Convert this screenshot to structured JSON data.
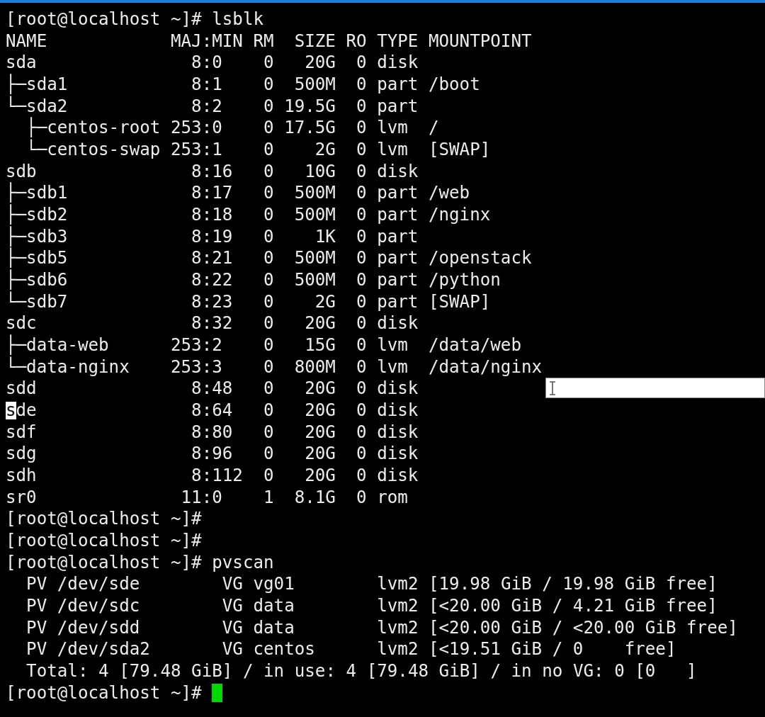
{
  "blocks": [
    {
      "kind": "prompt",
      "text": "[root@localhost ~]# lsblk",
      "cursor": false
    },
    {
      "kind": "lsblk",
      "columns": [
        "NAME",
        "MAJ:MIN",
        "RM",
        "SIZE",
        "RO",
        "TYPE",
        "MOUNTPOINT"
      ],
      "rows": [
        {
          "name": "sda",
          "maj_min": "8:0",
          "rm": "0",
          "size": "20G",
          "ro": "0",
          "type": "disk",
          "mountpoint": "",
          "cursor": false,
          "selection": false
        },
        {
          "name": "├─sda1",
          "maj_min": "8:1",
          "rm": "0",
          "size": "500M",
          "ro": "0",
          "type": "part",
          "mountpoint": "/boot",
          "cursor": false,
          "selection": false
        },
        {
          "name": "└─sda2",
          "maj_min": "8:2",
          "rm": "0",
          "size": "19.5G",
          "ro": "0",
          "type": "part",
          "mountpoint": "",
          "cursor": false,
          "selection": false
        },
        {
          "name": "  ├─centos-root",
          "maj_min": "253:0",
          "rm": "0",
          "size": "17.5G",
          "ro": "0",
          "type": "lvm",
          "mountpoint": "/",
          "cursor": false,
          "selection": false
        },
        {
          "name": "  └─centos-swap",
          "maj_min": "253:1",
          "rm": "0",
          "size": "2G",
          "ro": "0",
          "type": "lvm",
          "mountpoint": "[SWAP]",
          "cursor": false,
          "selection": false
        },
        {
          "name": "sdb",
          "maj_min": "8:16",
          "rm": "0",
          "size": "10G",
          "ro": "0",
          "type": "disk",
          "mountpoint": "",
          "cursor": false,
          "selection": false
        },
        {
          "name": "├─sdb1",
          "maj_min": "8:17",
          "rm": "0",
          "size": "500M",
          "ro": "0",
          "type": "part",
          "mountpoint": "/web",
          "cursor": false,
          "selection": false
        },
        {
          "name": "├─sdb2",
          "maj_min": "8:18",
          "rm": "0",
          "size": "500M",
          "ro": "0",
          "type": "part",
          "mountpoint": "/nginx",
          "cursor": false,
          "selection": false
        },
        {
          "name": "├─sdb3",
          "maj_min": "8:19",
          "rm": "0",
          "size": "1K",
          "ro": "0",
          "type": "part",
          "mountpoint": "",
          "cursor": false,
          "selection": false
        },
        {
          "name": "├─sdb5",
          "maj_min": "8:21",
          "rm": "0",
          "size": "500M",
          "ro": "0",
          "type": "part",
          "mountpoint": "/openstack",
          "cursor": false,
          "selection": false
        },
        {
          "name": "├─sdb6",
          "maj_min": "8:22",
          "rm": "0",
          "size": "500M",
          "ro": "0",
          "type": "part",
          "mountpoint": "/python",
          "cursor": false,
          "selection": false
        },
        {
          "name": "└─sdb7",
          "maj_min": "8:23",
          "rm": "0",
          "size": "2G",
          "ro": "0",
          "type": "part",
          "mountpoint": "[SWAP]",
          "cursor": false,
          "selection": false
        },
        {
          "name": "sdc",
          "maj_min": "8:32",
          "rm": "0",
          "size": "20G",
          "ro": "0",
          "type": "disk",
          "mountpoint": "",
          "cursor": false,
          "selection": false
        },
        {
          "name": "├─data-web",
          "maj_min": "253:2",
          "rm": "0",
          "size": "15G",
          "ro": "0",
          "type": "lvm",
          "mountpoint": "/data/web",
          "cursor": false,
          "selection": false
        },
        {
          "name": "└─data-nginx",
          "maj_min": "253:3",
          "rm": "0",
          "size": "800M",
          "ro": "0",
          "type": "lvm",
          "mountpoint": "/data/nginx",
          "cursor": false,
          "selection": false
        },
        {
          "name": "sdd",
          "maj_min": "8:48",
          "rm": "0",
          "size": "20G",
          "ro": "0",
          "type": "disk",
          "mountpoint": "",
          "cursor": false,
          "selection": true
        },
        {
          "name": "sde",
          "maj_min": "8:64",
          "rm": "0",
          "size": "20G",
          "ro": "0",
          "type": "disk",
          "mountpoint": "",
          "cursor": true,
          "selection": false
        },
        {
          "name": "sdf",
          "maj_min": "8:80",
          "rm": "0",
          "size": "20G",
          "ro": "0",
          "type": "disk",
          "mountpoint": "",
          "cursor": false,
          "selection": false
        },
        {
          "name": "sdg",
          "maj_min": "8:96",
          "rm": "0",
          "size": "20G",
          "ro": "0",
          "type": "disk",
          "mountpoint": "",
          "cursor": false,
          "selection": false
        },
        {
          "name": "sdh",
          "maj_min": "8:112",
          "rm": "0",
          "size": "20G",
          "ro": "0",
          "type": "disk",
          "mountpoint": "",
          "cursor": false,
          "selection": false
        },
        {
          "name": "sr0",
          "maj_min": "11:0",
          "rm": "1",
          "size": "8.1G",
          "ro": "0",
          "type": "rom",
          "mountpoint": "",
          "cursor": false,
          "selection": false
        }
      ]
    },
    {
      "kind": "prompt",
      "text": "[root@localhost ~]#",
      "cursor": false
    },
    {
      "kind": "prompt",
      "text": "[root@localhost ~]#",
      "cursor": false
    },
    {
      "kind": "prompt",
      "text": "[root@localhost ~]# pvscan",
      "cursor": false
    },
    {
      "kind": "pvscan",
      "rows": [
        {
          "pv": "PV /dev/sde",
          "vg": "VG vg01",
          "fmt": "lvm2",
          "size": "[19.98 GiB / 19.98 GiB free]"
        },
        {
          "pv": "PV /dev/sdc",
          "vg": "VG data",
          "fmt": "lvm2",
          "size": "[<20.00 GiB / 4.21 GiB free]"
        },
        {
          "pv": "PV /dev/sdd",
          "vg": "VG data",
          "fmt": "lvm2",
          "size": "[<20.00 GiB / <20.00 GiB free]"
        },
        {
          "pv": "PV /dev/sda2",
          "vg": "VG centos",
          "fmt": "lvm2",
          "size": "[<19.51 GiB / 0    free]"
        }
      ],
      "total": "Total: 4 [79.48 GiB] / in use: 4 [79.48 GiB] / in no VG: 0 [0   ]"
    },
    {
      "kind": "prompt",
      "text": "[root@localhost ~]#",
      "cursor": true
    }
  ]
}
